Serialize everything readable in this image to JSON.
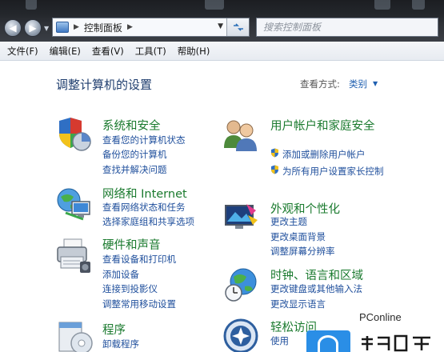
{
  "window": {
    "breadcrumb": "控制面板",
    "search_placeholder": "搜索控制面板"
  },
  "menu": [
    "文件(F)",
    "编辑(E)",
    "查看(V)",
    "工具(T)",
    "帮助(H)"
  ],
  "header": {
    "title": "调整计算机的设置",
    "view_by_label": "查看方式:",
    "view_by_value": "类别"
  },
  "categories": {
    "system": {
      "title": "系统和安全",
      "links": [
        "查看您的计算机状态",
        "备份您的计算机",
        "查找并解决问题"
      ]
    },
    "network": {
      "title": "网络和 Internet",
      "links": [
        "查看网络状态和任务",
        "选择家庭组和共享选项"
      ]
    },
    "hardware": {
      "title": "硬件和声音",
      "links": [
        "查看设备和打印机",
        "添加设备",
        "连接到投影仪",
        "调整常用移动设置"
      ]
    },
    "programs": {
      "title": "程序",
      "links": [
        "卸载程序"
      ]
    },
    "users": {
      "title": "用户帐户和家庭安全",
      "links": [
        "添加或删除用户帐户",
        "为所有用户设置家长控制"
      ]
    },
    "appearance": {
      "title": "外观和个性化",
      "links": [
        "更改主题",
        "更改桌面背景",
        "调整屏幕分辨率"
      ]
    },
    "clock": {
      "title": "时钟、语言和区域",
      "links": [
        "更改键盘或其他输入法",
        "更改显示语言"
      ]
    },
    "access": {
      "title": "轻松访问",
      "links": [
        "使用"
      ]
    }
  },
  "watermark": {
    "text": "PConline"
  },
  "colors": {
    "title_blue": "#1e3d6e",
    "category_green": "#1a7a2e",
    "link_blue": "#1f4f9c"
  }
}
